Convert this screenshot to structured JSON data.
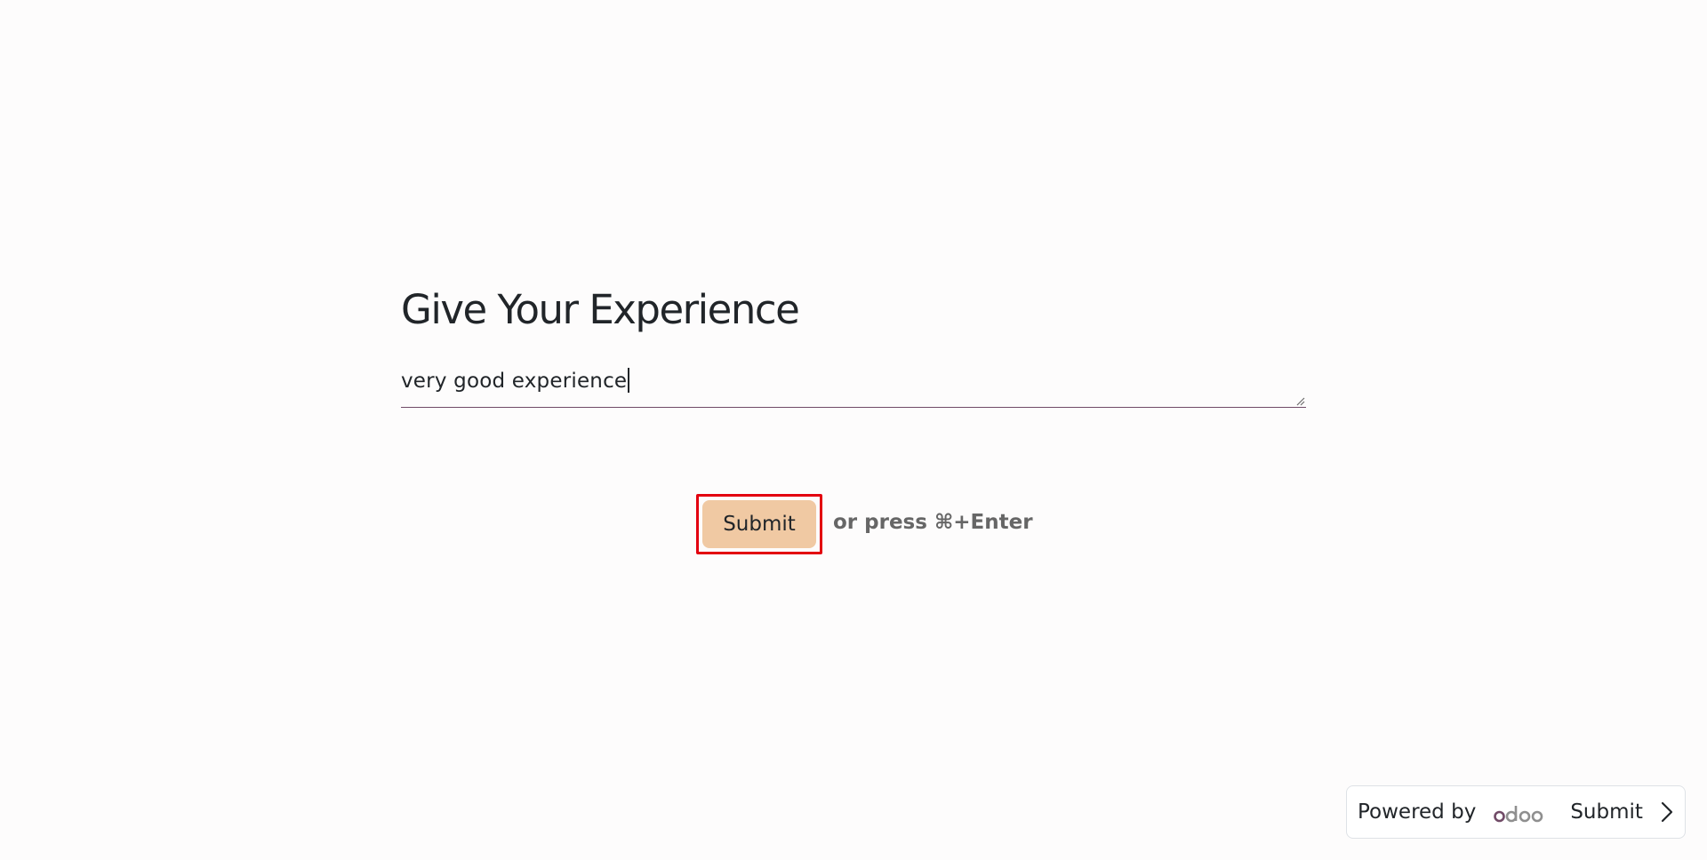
{
  "question": {
    "title": "Give Your Experience",
    "answer_value": "very good experience"
  },
  "actions": {
    "submit_label": "Submit",
    "shortcut_hint": "or press ⌘+Enter"
  },
  "footer": {
    "powered_by": "Powered by",
    "brand": "odoo",
    "submit_label": "Submit",
    "chevron_icon": "chevron-right-icon"
  },
  "colors": {
    "background": "#fdfcfc",
    "submit_button_bg": "#f0c9a3",
    "highlight_outline": "#e3000f",
    "input_underline": "#714b67",
    "hint_text": "#666666"
  }
}
